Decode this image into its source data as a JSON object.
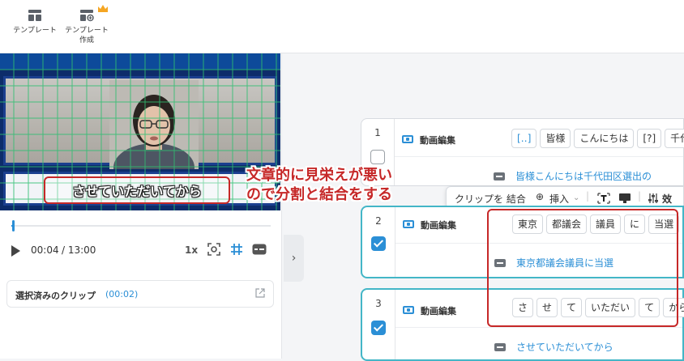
{
  "toolbar": {
    "template_label": "テンプレート",
    "create_template_label_line1": "テンプレート",
    "create_template_label_line2": "作成",
    "crown_color": "#f5a623"
  },
  "preview": {
    "caption_text": "させていただいてから",
    "progress_fraction": 0.005
  },
  "player": {
    "current_time": "00:04",
    "total_time": "/ 13:00",
    "speed": "1x"
  },
  "selected_clips": {
    "label": "選択済みのクリップ",
    "count": "(00:02)"
  },
  "annotation": {
    "line1": "文章的に見栄えが悪い",
    "line2": "ので分割と結合をする",
    "color": "#c62828"
  },
  "floating_toolbar": {
    "merge_clips": "クリップを 結合",
    "insert": "挿入",
    "effects_partial": "效"
  },
  "rows": [
    {
      "number": "1",
      "checked": false,
      "label": "動画編集",
      "chips": [
        "[‥]",
        "皆様",
        "こんにちは",
        "[?]",
        "千代田"
      ],
      "subtitle": "皆様こんにちは千代田区選出の"
    },
    {
      "number": "2",
      "checked": true,
      "label": "動画編集",
      "chips": [
        "東京",
        "都議会",
        "議員",
        "に",
        "当選"
      ],
      "subtitle": "東京都議会議員に当選"
    },
    {
      "number": "3",
      "checked": true,
      "label": "動画編集",
      "chips": [
        "さ",
        "せ",
        "て",
        "いただい",
        "て",
        "から"
      ],
      "subtitle": "させていただいてから"
    }
  ]
}
